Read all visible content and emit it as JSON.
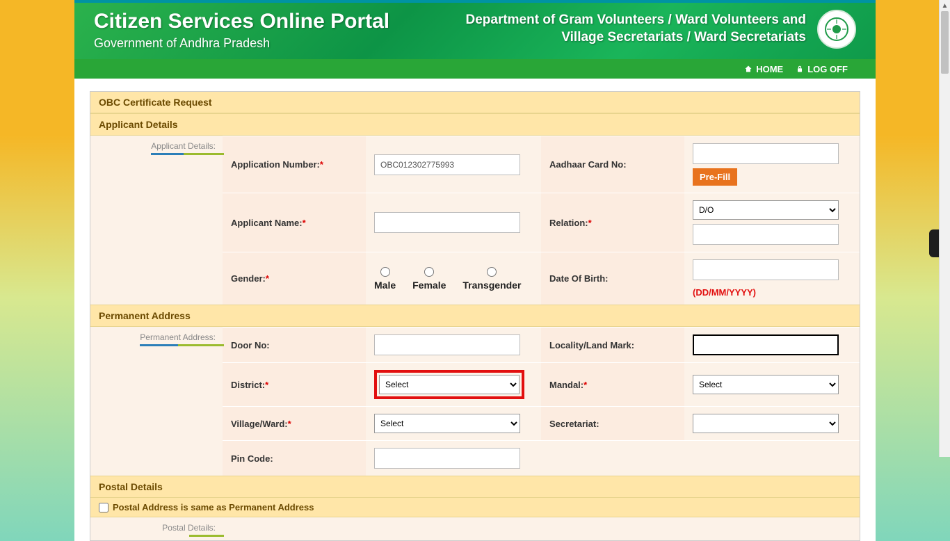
{
  "header": {
    "portal_title": "Citizen Services Online Portal",
    "portal_subtitle": "Government of Andhra Pradesh",
    "dept_line1": "Department of Gram Volunteers / Ward Volunteers and",
    "dept_line2": "Village Secretariats / Ward Secretariats"
  },
  "nav": {
    "home": "HOME",
    "logoff": "LOG OFF"
  },
  "form": {
    "page_title": "OBC Certificate Request",
    "applicant": {
      "section_title": "Applicant Details",
      "tab_label": "Applicant Details:",
      "app_number_label": "Application Number:",
      "app_number_value": "OBC012302775993",
      "aadhaar_label": "Aadhaar Card No:",
      "aadhaar_value": "",
      "prefill_btn": "Pre-Fill",
      "name_label": "Applicant Name:",
      "name_value": "",
      "relation_label": "Relation:",
      "relation_selected": "D/O",
      "relation_name_value": "",
      "gender_label": "Gender:",
      "gender_options": {
        "male": "Male",
        "female": "Female",
        "trans": "Transgender"
      },
      "dob_label": "Date Of Birth:",
      "dob_value": "",
      "dob_hint": "(DD/MM/YYYY)"
    },
    "permanent_address": {
      "section_title": "Permanent Address",
      "tab_label": "Permanent Address:",
      "door_label": "Door No:",
      "door_value": "",
      "locality_label": "Locality/Land Mark:",
      "locality_value": "",
      "district_label": "District:",
      "district_selected": "Select",
      "mandal_label": "Mandal:",
      "mandal_selected": "Select",
      "village_label": "Village/Ward:",
      "village_selected": "Select",
      "secretariat_label": "Secretariat:",
      "secretariat_selected": "",
      "pincode_label": "Pin Code:",
      "pincode_value": ""
    },
    "postal": {
      "section_title": "Postal Details",
      "same_as_label": "Postal Address is same as Permanent Address",
      "tab_label": "Postal Details:"
    }
  }
}
